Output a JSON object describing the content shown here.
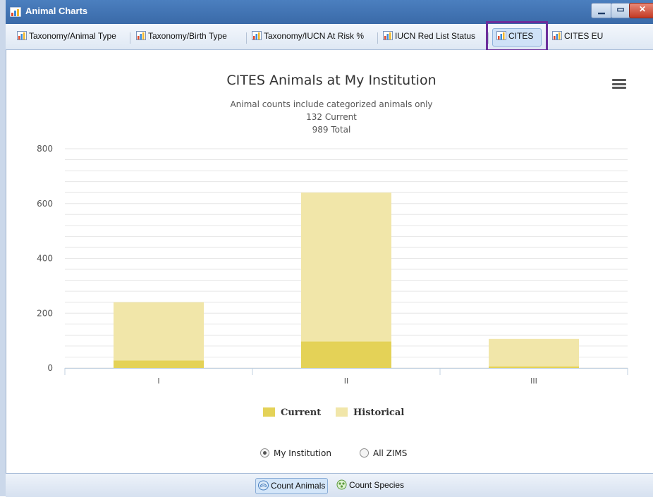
{
  "window": {
    "title": "Animal Charts"
  },
  "tabs": [
    {
      "label": "Taxonomy/Animal Type"
    },
    {
      "label": "Taxonomy/Birth Type"
    },
    {
      "label": "Taxonomy/IUCN At Risk %"
    },
    {
      "label": "IUCN Red List Status"
    },
    {
      "label": "CITES",
      "active": true
    },
    {
      "label": "CITES EU"
    }
  ],
  "chart": {
    "title": "CITES Animals at My Institution",
    "subtitle_lines": [
      "Animal counts include categorized animals only",
      "132 Current",
      "989 Total"
    ]
  },
  "chart_data": {
    "type": "bar",
    "stacked": true,
    "title": "CITES Animals at My Institution",
    "categories": [
      "I",
      "II",
      "III"
    ],
    "series": [
      {
        "name": "Current",
        "values": [
          27,
          97,
          6
        ],
        "color": "#e4d257"
      },
      {
        "name": "Historical",
        "values": [
          213,
          543,
          100
        ],
        "color": "#f1e6a9"
      }
    ],
    "ylim": [
      0,
      800
    ],
    "yticks": [
      0,
      200,
      400,
      600,
      800
    ],
    "grid": true,
    "legend": "bottom-center"
  },
  "legend": [
    {
      "label": "Current",
      "color": "#e4d257"
    },
    {
      "label": "Historical",
      "color": "#f1e6a9"
    }
  ],
  "radios": [
    {
      "label": "My Institution",
      "checked": true
    },
    {
      "label": "All ZIMS",
      "checked": false
    }
  ],
  "footer": {
    "buttons": [
      {
        "label": "Count Animals",
        "active": true
      },
      {
        "label": "Count Species",
        "active": false
      }
    ]
  }
}
